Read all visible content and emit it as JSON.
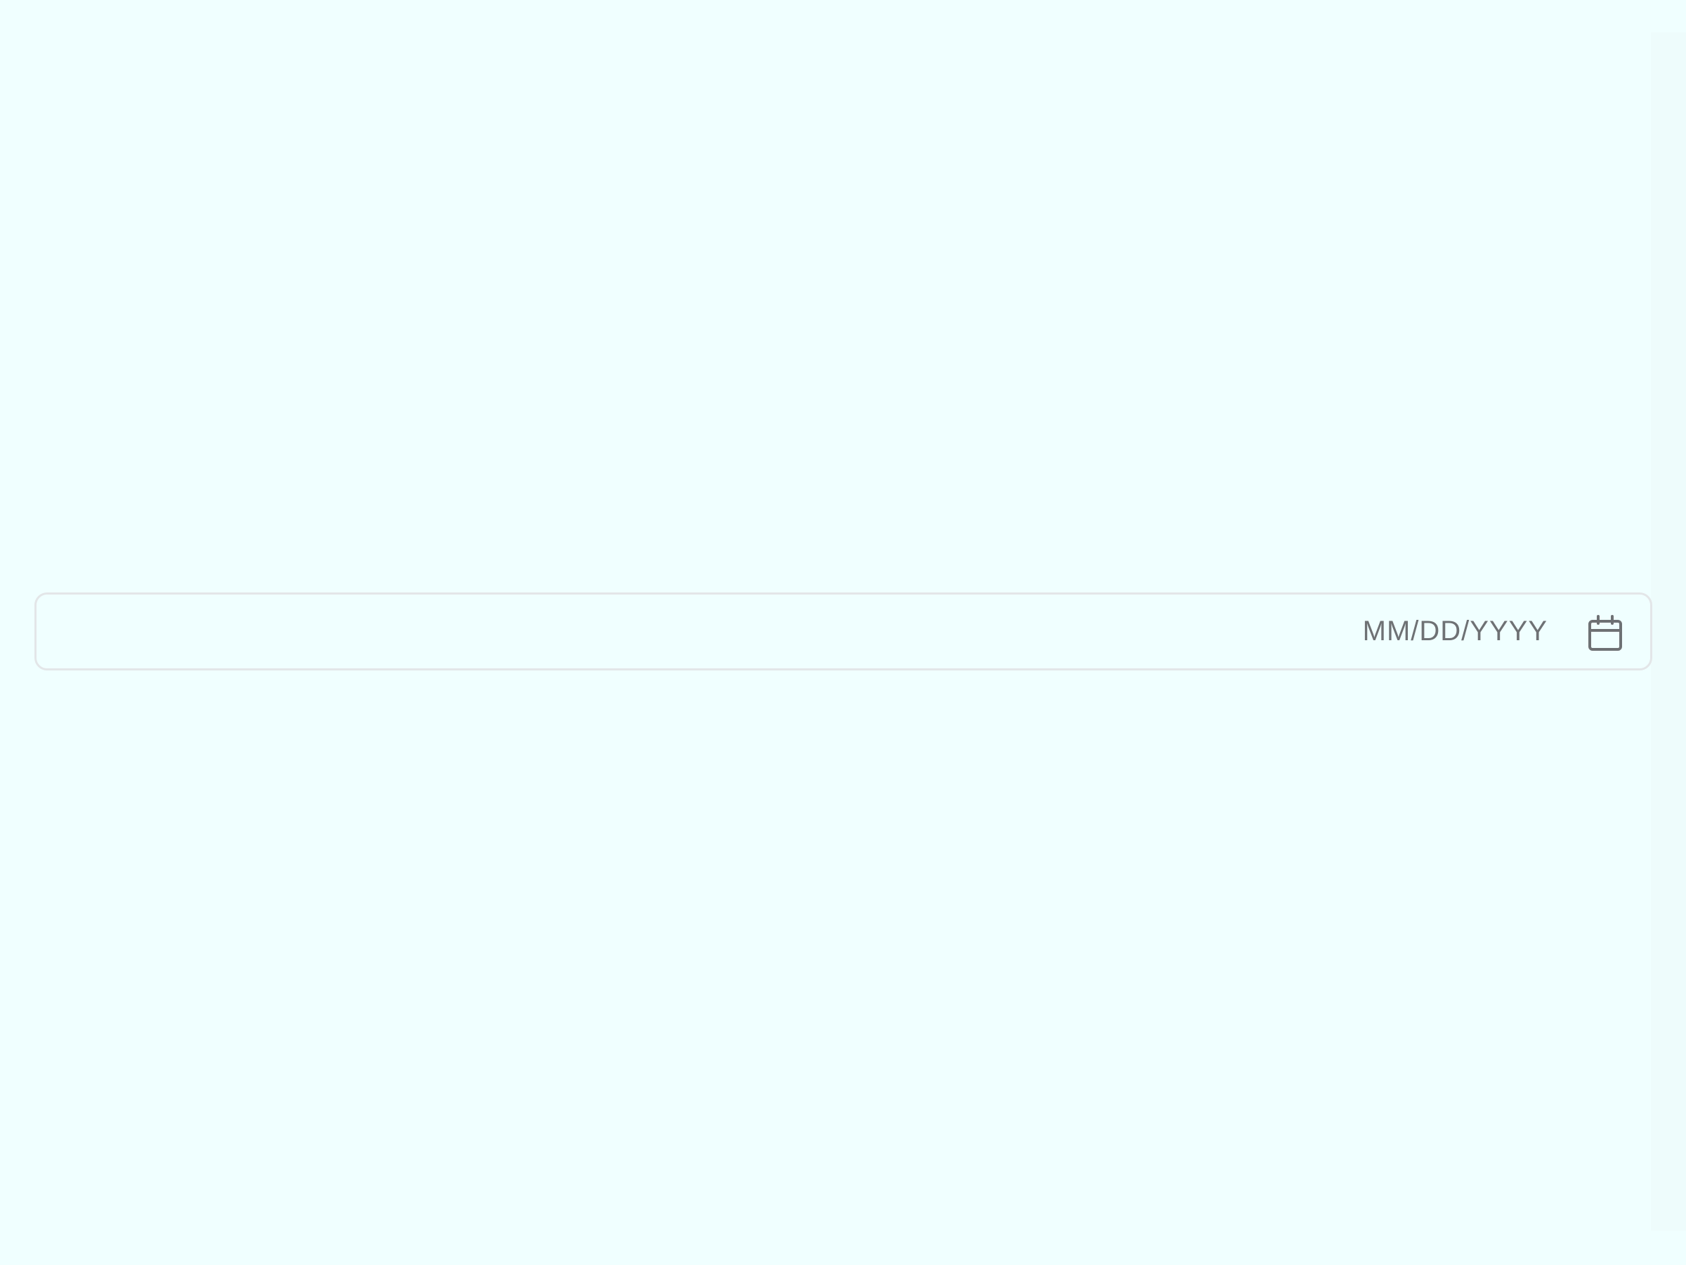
{
  "date_field": {
    "value": "",
    "placeholder": "MM/DD/YYYY",
    "icon": "calendar-icon"
  },
  "colors": {
    "background": "#F0FFFF",
    "border": "#E3E6E8",
    "placeholder_text": "#6E7174",
    "icon": "#6E7174"
  }
}
